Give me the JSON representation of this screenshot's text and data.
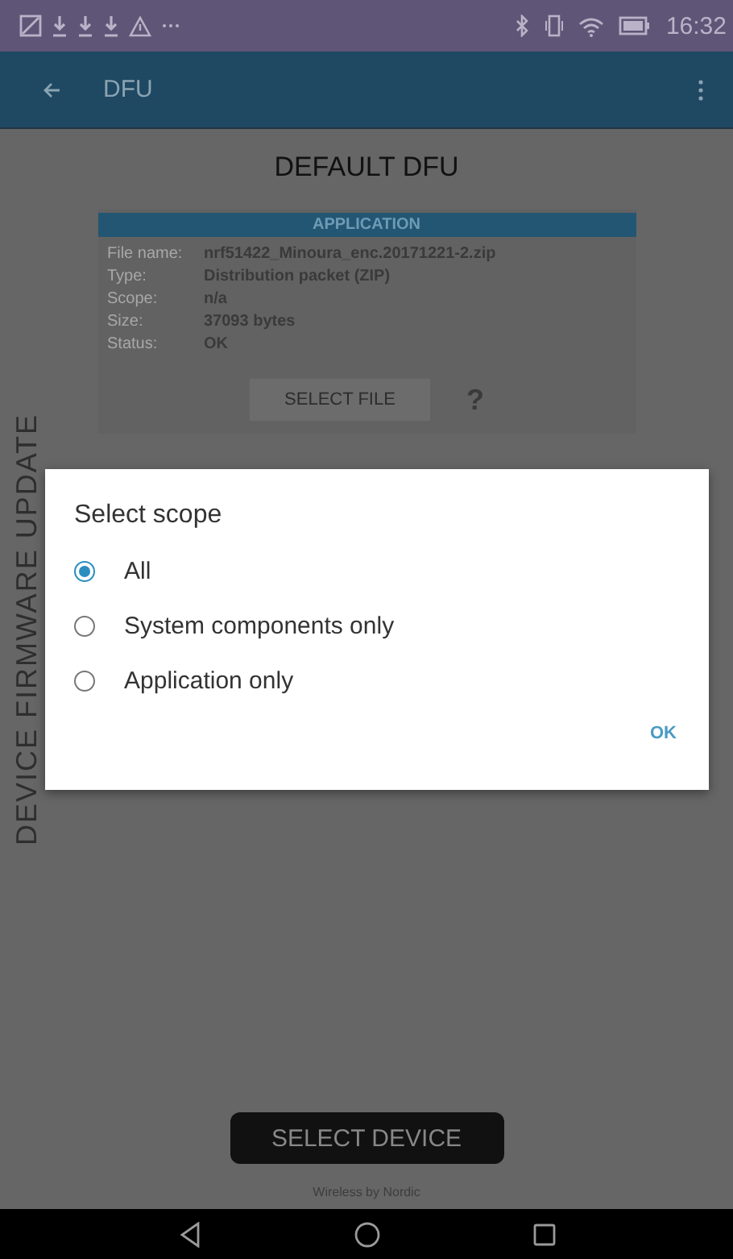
{
  "status_bar": {
    "time": "16:32"
  },
  "app_bar": {
    "title": "DFU"
  },
  "heading": "DEFAULT DFU",
  "side_label": "DEVICE FIRMWARE UPDATE",
  "application_card": {
    "header": "APPLICATION",
    "fields": [
      {
        "label": "File name:",
        "value": "nrf51422_Minoura_enc.20171221-2.zip"
      },
      {
        "label": "Type:",
        "value": "Distribution packet (ZIP)"
      },
      {
        "label": "Scope:",
        "value": "n/a"
      },
      {
        "label": "Size:",
        "value": "37093 bytes"
      },
      {
        "label": "Status:",
        "value": "OK"
      }
    ],
    "select_file": "SELECT FILE",
    "help": "?"
  },
  "dialog": {
    "title": "Select scope",
    "options": [
      {
        "label": "All",
        "selected": true
      },
      {
        "label": "System components only",
        "selected": false
      },
      {
        "label": "Application only",
        "selected": false
      }
    ],
    "ok": "OK"
  },
  "select_device": "SELECT DEVICE",
  "footer": "Wireless by Nordic"
}
